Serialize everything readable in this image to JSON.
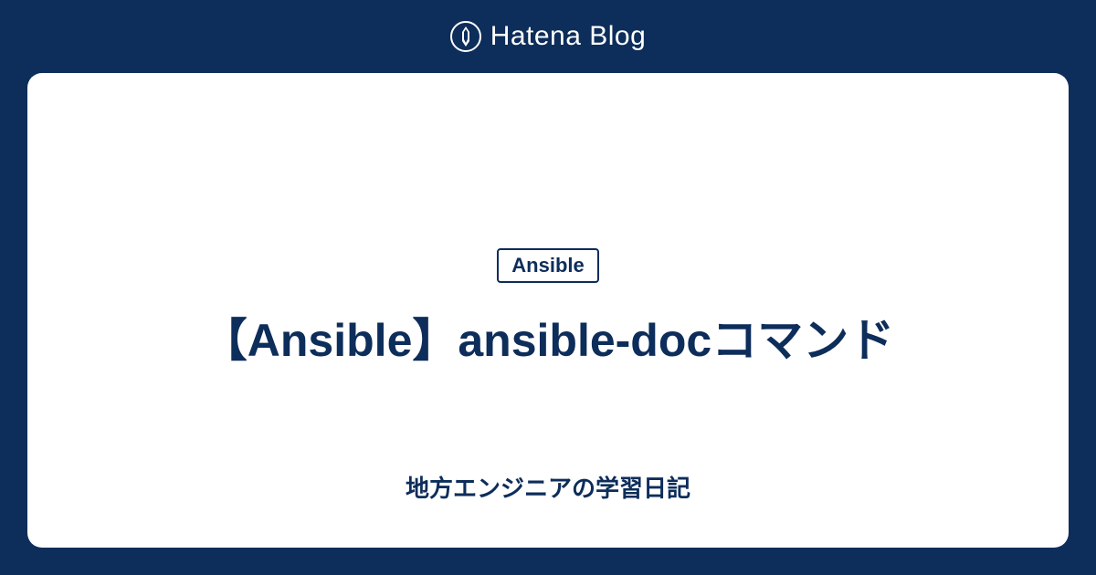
{
  "brand": "Hatena Blog",
  "card": {
    "tag": "Ansible",
    "title": "【Ansible】ansible-docコマンド",
    "subtitle": "地方エンジニアの学習日記"
  },
  "colors": {
    "background": "#0d2d5a",
    "card_bg": "#ffffff",
    "text": "#0d2d5a"
  }
}
